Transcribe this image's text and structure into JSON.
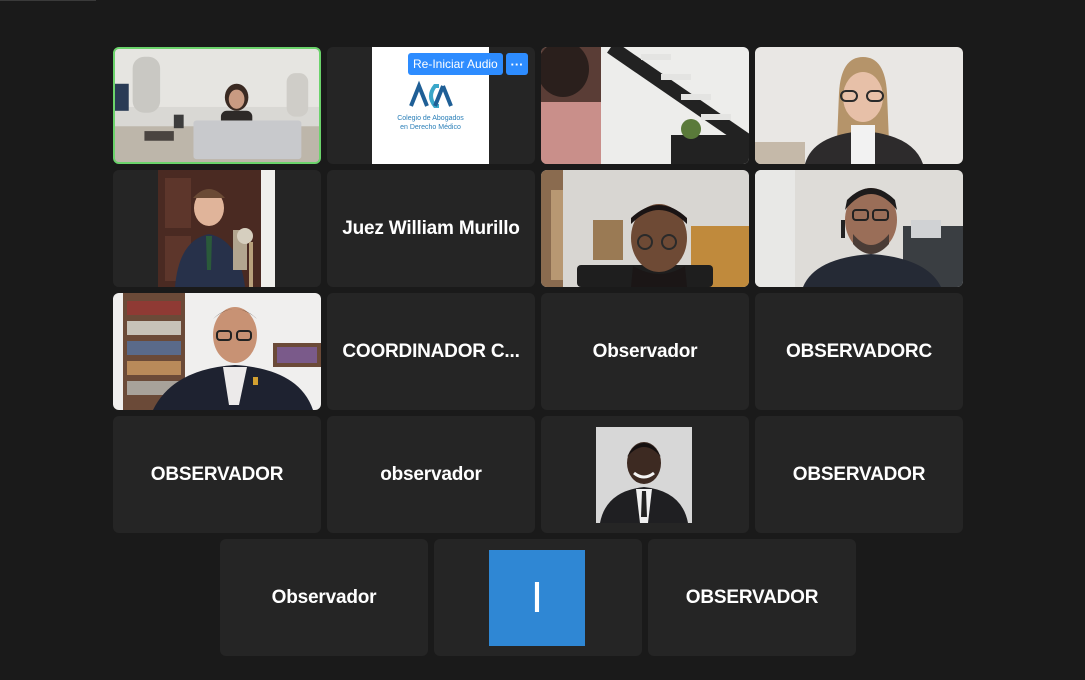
{
  "colors": {
    "background": "#1a1a1a",
    "tile": "#252525",
    "active_speaker_border": "#6bd36b",
    "accent_blue": "#2d8cff",
    "initial_tile": "#2f87d4"
  },
  "tiles": {
    "t1": {
      "type": "video"
    },
    "t2": {
      "type": "logo",
      "logo_lines": [
        "Colegio de Abogados",
        "en Derecho Médico"
      ],
      "reaudio_label": "Re-Iniciar Audio",
      "more_label": "···"
    },
    "t3": {
      "type": "video"
    },
    "t4": {
      "type": "video"
    },
    "t5": {
      "type": "video"
    },
    "t6": {
      "type": "name",
      "name": "Juez William Murillo"
    },
    "t7": {
      "type": "video"
    },
    "t8": {
      "type": "video"
    },
    "t9": {
      "type": "video"
    },
    "t10": {
      "type": "name",
      "name": "COORDINADOR C..."
    },
    "t11": {
      "type": "name",
      "name": "Observador"
    },
    "t12": {
      "type": "name",
      "name": "OBSERVADORC"
    },
    "t13": {
      "type": "name",
      "name": "OBSERVADOR"
    },
    "t14": {
      "type": "name",
      "name": "observador"
    },
    "t15": {
      "type": "profile-photo"
    },
    "t16": {
      "type": "name",
      "name": "OBSERVADOR"
    },
    "t17": {
      "type": "name",
      "name": "Observador"
    },
    "t18": {
      "type": "initial",
      "initial": "I"
    },
    "t19": {
      "type": "name",
      "name": "OBSERVADOR"
    }
  }
}
